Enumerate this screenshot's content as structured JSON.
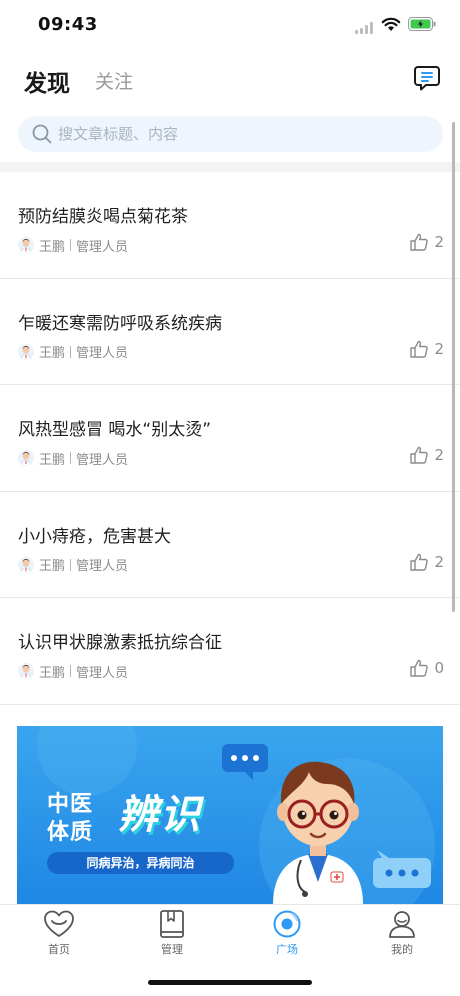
{
  "status": {
    "time": "09:43"
  },
  "header": {
    "tab_discover": "发现",
    "tab_follow": "关注",
    "message_icon": "message-icon"
  },
  "search": {
    "placeholder": "搜文章标题、内容",
    "value": ""
  },
  "articles": [
    {
      "title": "预防结膜炎喝点菊花茶",
      "author": "王鹏",
      "role": "管理人员",
      "likes": "2"
    },
    {
      "title": "乍暖还寒需防呼吸系统疾病",
      "author": "王鹏",
      "role": "管理人员",
      "likes": "2"
    },
    {
      "title": "风热型感冒 喝水“别太烫”",
      "author": "王鹏",
      "role": "管理人员",
      "likes": "2"
    },
    {
      "title": "小小痔疮，危害甚大",
      "author": "王鹏",
      "role": "管理人员",
      "likes": "2"
    },
    {
      "title": "认识甲状腺激素抵抗综合征",
      "author": "王鹏",
      "role": "管理人员",
      "likes": "0"
    }
  ],
  "banner": {
    "line1": "中医",
    "line2": "体质",
    "headline": "辨识",
    "slogan": "同病异治，异病同治"
  },
  "tabbar": {
    "items": [
      {
        "label": "首页",
        "icon": "heart-icon"
      },
      {
        "label": "管理",
        "icon": "book-icon"
      },
      {
        "label": "广场",
        "icon": "plaza-icon",
        "active": true
      },
      {
        "label": "我的",
        "icon": "profile-icon"
      }
    ]
  },
  "colors": {
    "accent": "#2e9af5",
    "banner": "#2a96ea",
    "search_bg": "#eef5fd"
  }
}
